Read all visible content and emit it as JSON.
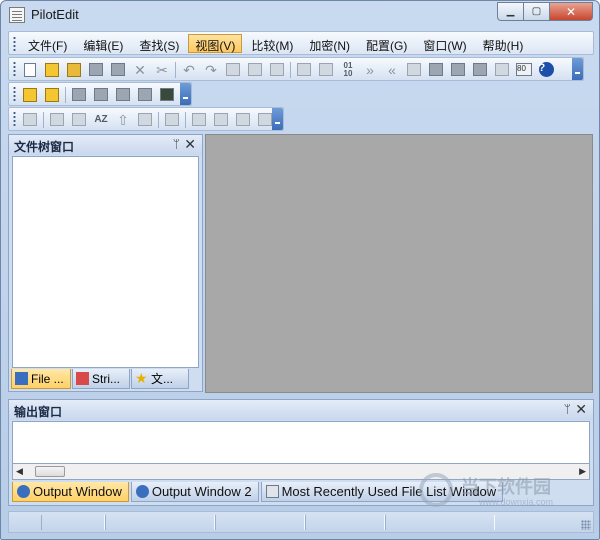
{
  "window": {
    "title": "PilotEdit"
  },
  "menu": {
    "items": [
      {
        "label": "文件(F)"
      },
      {
        "label": "编辑(E)"
      },
      {
        "label": "查找(S)"
      },
      {
        "label": "视图(V)"
      },
      {
        "label": "比较(M)"
      },
      {
        "label": "加密(N)"
      },
      {
        "label": "配置(G)"
      },
      {
        "label": "窗口(W)"
      },
      {
        "label": "帮助(H)"
      }
    ],
    "active_index": 3
  },
  "toolbar_main": {
    "icons": [
      "new-file-icon",
      "open-file-icon",
      "open-folder-icon",
      "save-icon",
      "save-all-icon",
      "close-file-icon",
      "cut-icon",
      "undo-icon",
      "redo-icon",
      "copy-icon",
      "paste-icon",
      "clipboard-icon",
      "find-in-files-icon",
      "replace-icon",
      "hex-icon",
      "next-icon",
      "previous-icon",
      "ftp-icon",
      "compile-icon",
      "build-icon",
      "run-icon",
      "settings-icon",
      "ascii-icon",
      "help-icon"
    ],
    "hex_label": "01\n10",
    "ascii_label": "80",
    "help_label": "?"
  },
  "toolbar_second": {
    "icons": [
      "bookmark-icon",
      "bookmark-next-icon",
      "column-mode-icon",
      "wrap-icon",
      "macro-icon",
      "macro-play-icon",
      "encoding-icon"
    ]
  },
  "toolbar_third": {
    "icons": [
      "indent-icon",
      "new-window-icon",
      "spell-check-icon",
      "sort-az-icon",
      "sort-up-icon",
      "list-icon",
      "screenshot-icon",
      "expand-icon",
      "zoom-in-icon",
      "zoom-out-icon",
      "window-icon"
    ],
    "sort_label": "AZ"
  },
  "file_tree": {
    "title": "文件树窗口",
    "pin": "ᛘ",
    "close": "✕",
    "tabs": [
      {
        "label": "File ...",
        "icon": "file-tree-icon"
      },
      {
        "label": "Stri...",
        "icon": "string-icon"
      },
      {
        "label": "文...",
        "icon": "favorites-star-icon"
      }
    ]
  },
  "output": {
    "title": "输出窗口",
    "pin": "ᛘ",
    "close": "✕",
    "tabs": [
      {
        "label": "Output Window",
        "icon": "output-icon"
      },
      {
        "label": "Output Window 2",
        "icon": "output-icon"
      },
      {
        "label": "Most Recently Used File List Window",
        "icon": "recent-files-icon"
      }
    ]
  },
  "watermark": {
    "title": "当下软件园",
    "url": "www.downxia.com"
  },
  "colors": {
    "active_tab": "#ffd066",
    "panel_bg": "#cfddf0",
    "editor_bg": "#a8a8a8"
  }
}
